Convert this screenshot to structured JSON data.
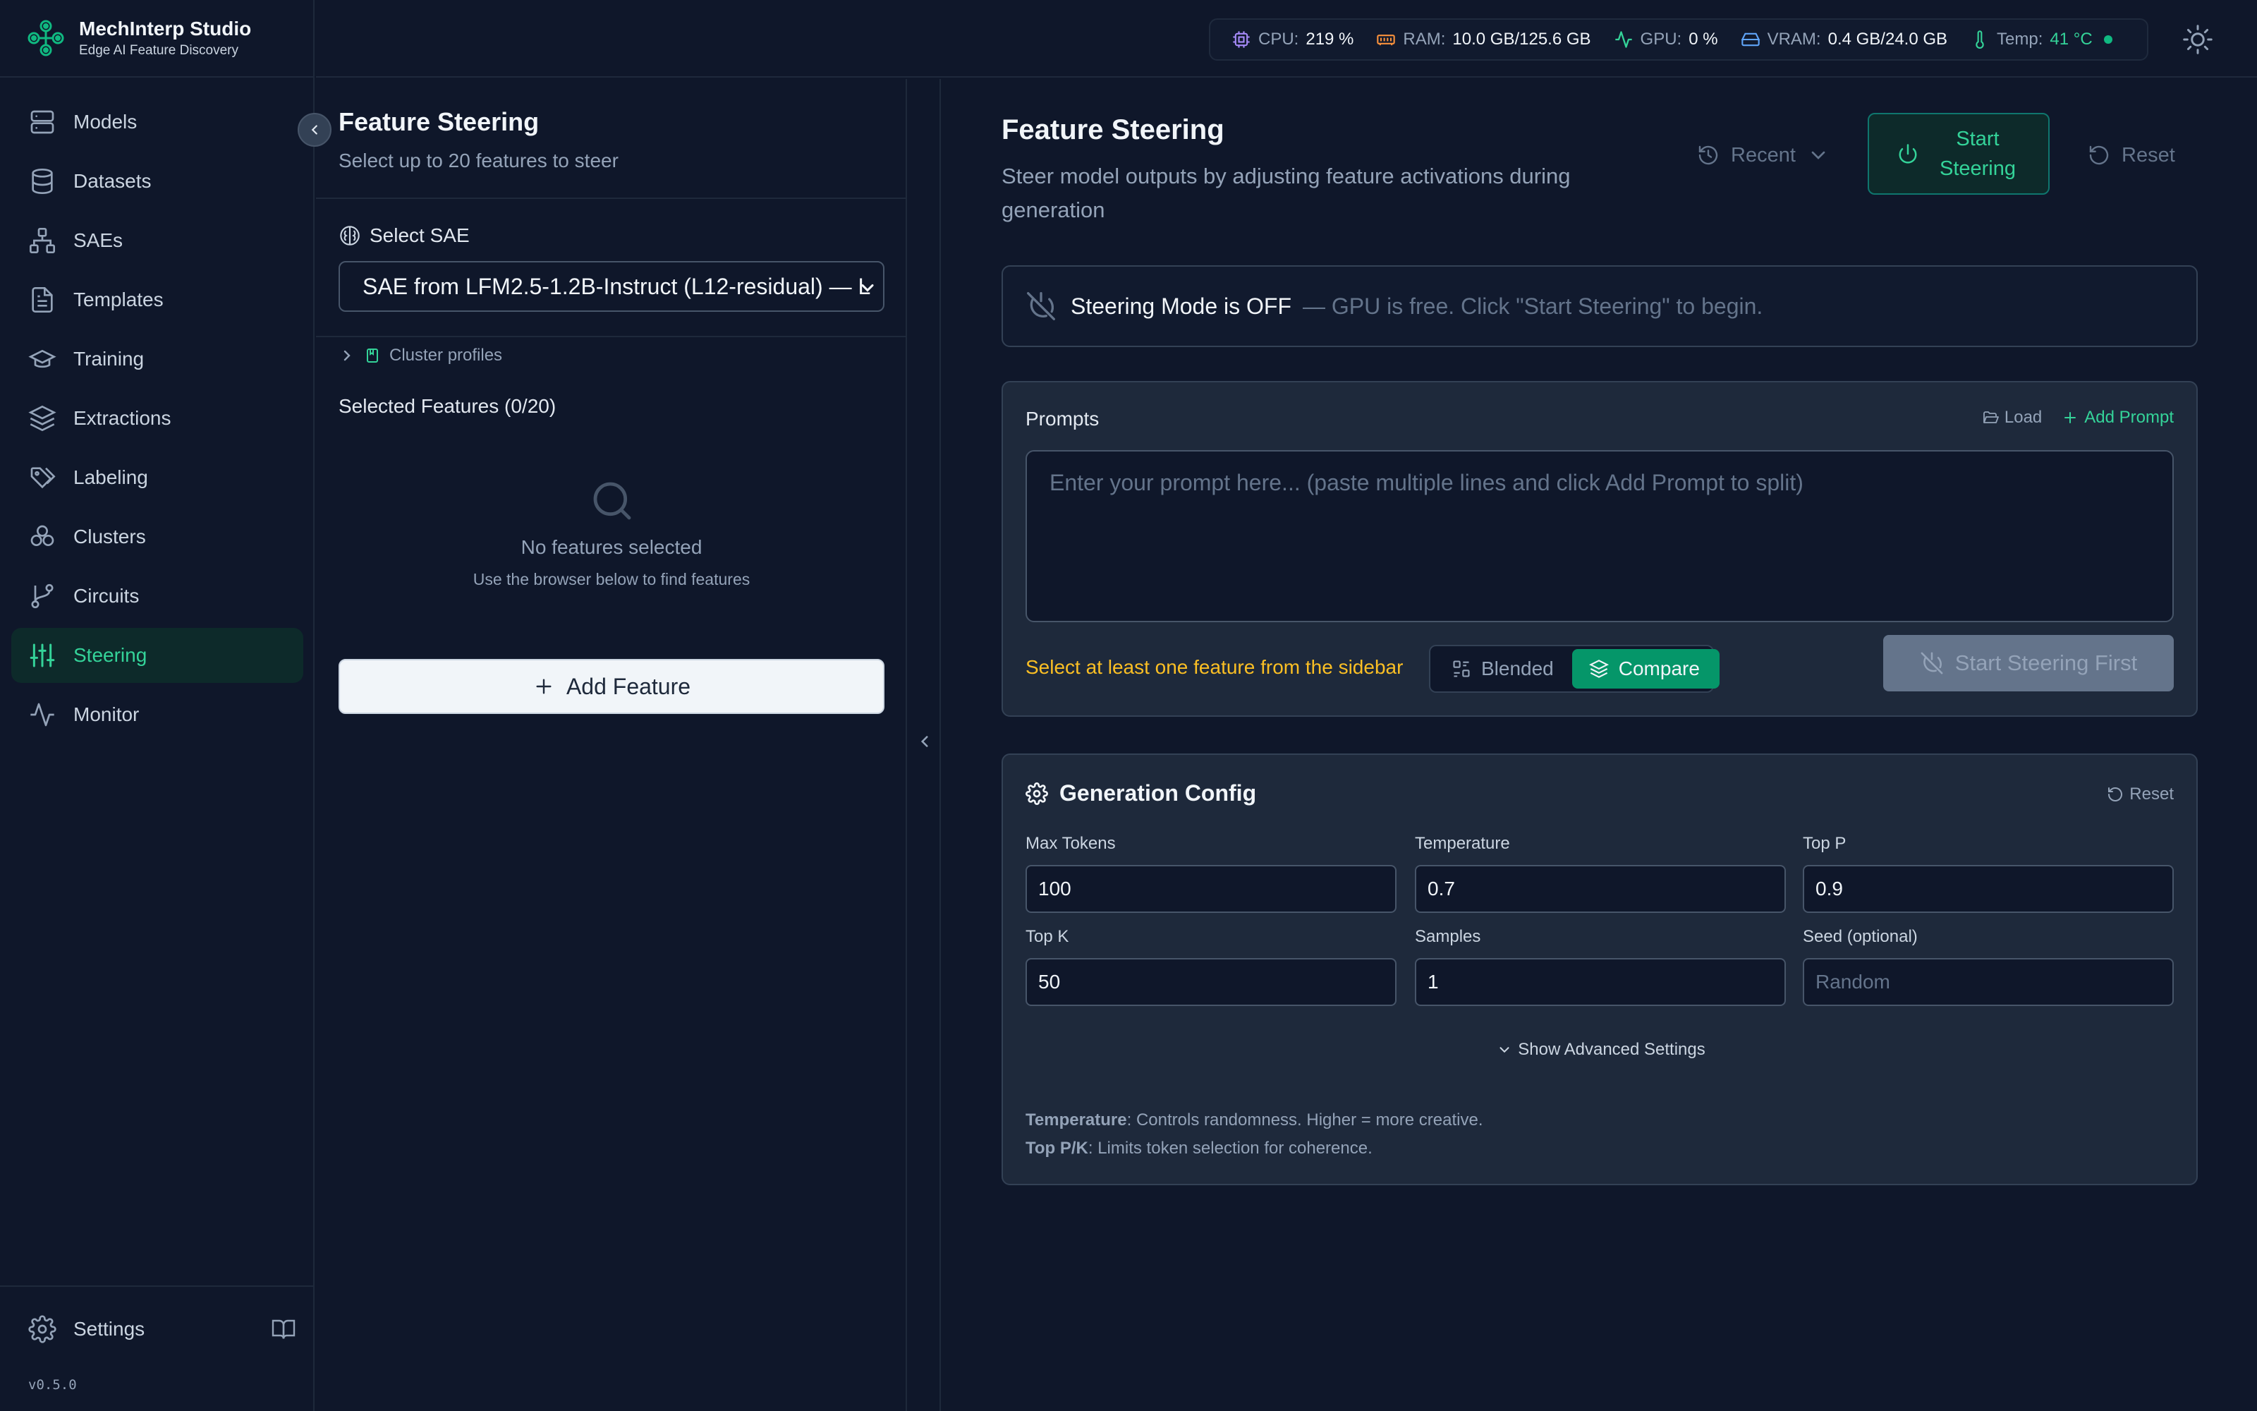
{
  "app": {
    "title": "MechInterp Studio",
    "subtitle": "Edge AI Feature Discovery",
    "version": "v0.5.0"
  },
  "sidebar": {
    "items": [
      {
        "label": "Models",
        "icon": "server-icon",
        "active": false
      },
      {
        "label": "Datasets",
        "icon": "database-icon",
        "active": false
      },
      {
        "label": "SAEs",
        "icon": "network-icon",
        "active": false
      },
      {
        "label": "Templates",
        "icon": "file-text-icon",
        "active": false
      },
      {
        "label": "Training",
        "icon": "graduation-cap-icon",
        "active": false
      },
      {
        "label": "Extractions",
        "icon": "layers-icon",
        "active": false
      },
      {
        "label": "Labeling",
        "icon": "tags-icon",
        "active": false
      },
      {
        "label": "Clusters",
        "icon": "clusters-icon",
        "active": false
      },
      {
        "label": "Circuits",
        "icon": "git-branch-icon",
        "active": false
      },
      {
        "label": "Steering",
        "icon": "sliders-icon",
        "active": true
      },
      {
        "label": "Monitor",
        "icon": "activity-icon",
        "active": false
      }
    ],
    "settings_label": "Settings"
  },
  "metrics": {
    "cpu_label": "CPU:",
    "cpu_value": "219 %",
    "ram_label": "RAM:",
    "ram_value": "10.0 GB/125.6 GB",
    "gpu_label": "GPU:",
    "gpu_value": "0 %",
    "vram_label": "VRAM:",
    "vram_value": "0.4 GB/24.0 GB",
    "temp_label": "Temp:",
    "temp_value": "41 °C"
  },
  "feature_panel": {
    "title": "Feature Steering",
    "subtitle": "Select up to 20 features to steer",
    "select_sae_label": "Select SAE",
    "sae_value": "SAE from LFM2.5-1.2B-Instruct (L12-residual) — L",
    "cluster_profiles": "Cluster profiles",
    "selected_title": "Selected Features (0/20)",
    "empty_title": "No features selected",
    "empty_sub": "Use the browser below to find features",
    "add_feature": "Add Feature"
  },
  "main": {
    "title": "Feature Steering",
    "subtitle": "Steer model outputs by adjusting feature activations during generation",
    "recent_label": "Recent",
    "start_label": "Start Steering",
    "reset_label": "Reset",
    "mode_status": "Steering Mode is OFF",
    "mode_hint": "— GPU is free. Click \"Start Steering\" to begin.",
    "prompts": {
      "title": "Prompts",
      "load_label": "Load",
      "add_label": "Add Prompt",
      "placeholder": "Enter your prompt here... (paste multiple lines and click Add Prompt to split)",
      "warning": "Select at least one feature from the sidebar",
      "blended_label": "Blended",
      "compare_label": "Compare",
      "action_label": "Start Steering First"
    },
    "gen_config": {
      "title": "Generation Config",
      "reset_label": "Reset",
      "fields": [
        {
          "label": "Max Tokens",
          "value": "100"
        },
        {
          "label": "Temperature",
          "value": "0.7"
        },
        {
          "label": "Top P",
          "value": "0.9"
        },
        {
          "label": "Top K",
          "value": "50"
        },
        {
          "label": "Samples",
          "value": "1"
        },
        {
          "label": "Seed (optional)",
          "value": "",
          "placeholder": "Random"
        }
      ],
      "advanced_label": "Show Advanced Settings",
      "help_temp_term": "Temperature",
      "help_temp_text": ": Controls randomness. Higher = more creative.",
      "help_topk_term": "Top P/K",
      "help_topk_text": ": Limits token selection for coherence."
    }
  },
  "colors": {
    "accent": "#34d399",
    "accent_strong": "#059669",
    "warning": "#fbbf24",
    "background": "#0f172a",
    "card": "#1e293b"
  }
}
